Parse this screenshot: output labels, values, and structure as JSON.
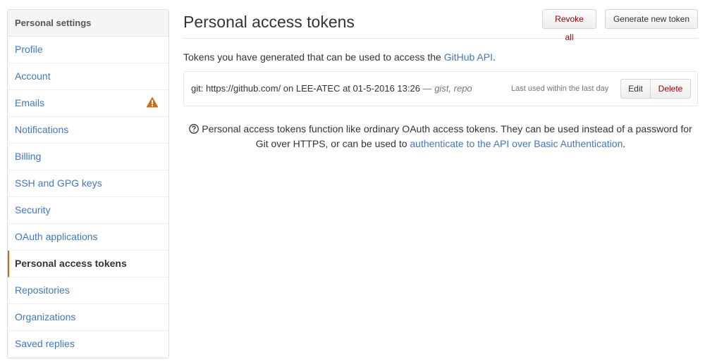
{
  "sidebar": {
    "header": "Personal settings",
    "items": [
      {
        "label": "Profile"
      },
      {
        "label": "Account"
      },
      {
        "label": "Emails"
      },
      {
        "label": "Notifications"
      },
      {
        "label": "Billing"
      },
      {
        "label": "SSH and GPG keys"
      },
      {
        "label": "Security"
      },
      {
        "label": "OAuth applications"
      },
      {
        "label": "Personal access tokens"
      },
      {
        "label": "Repositories"
      },
      {
        "label": "Organizations"
      },
      {
        "label": "Saved replies"
      }
    ],
    "selected_index": 8,
    "warning_icon_color": "#d26911"
  },
  "main": {
    "title": "Personal access tokens",
    "revoke_all_label": "Revoke all",
    "generate_label": "Generate new token",
    "intro_text": "Tokens you have generated that can be used to access the ",
    "intro_link": "GitHub API",
    "intro_suffix": ".",
    "token": {
      "description": "git: https://github.com/ on LEE-ATEC at 01-5-2016 13:26",
      "separator": " — ",
      "scopes": "gist, repo",
      "last_used": "Last used within the last day",
      "edit_label": "Edit",
      "delete_label": "Delete"
    },
    "help_text": "Personal access tokens function like ordinary OAuth access tokens. They can be used instead of a password for Git over HTTPS, or can be used to ",
    "help_link": "authenticate to the API over Basic Authentication",
    "help_suffix": "."
  },
  "colors": {
    "link": "#4078c0",
    "danger": "#990000",
    "selected_accent": "#d26911"
  }
}
